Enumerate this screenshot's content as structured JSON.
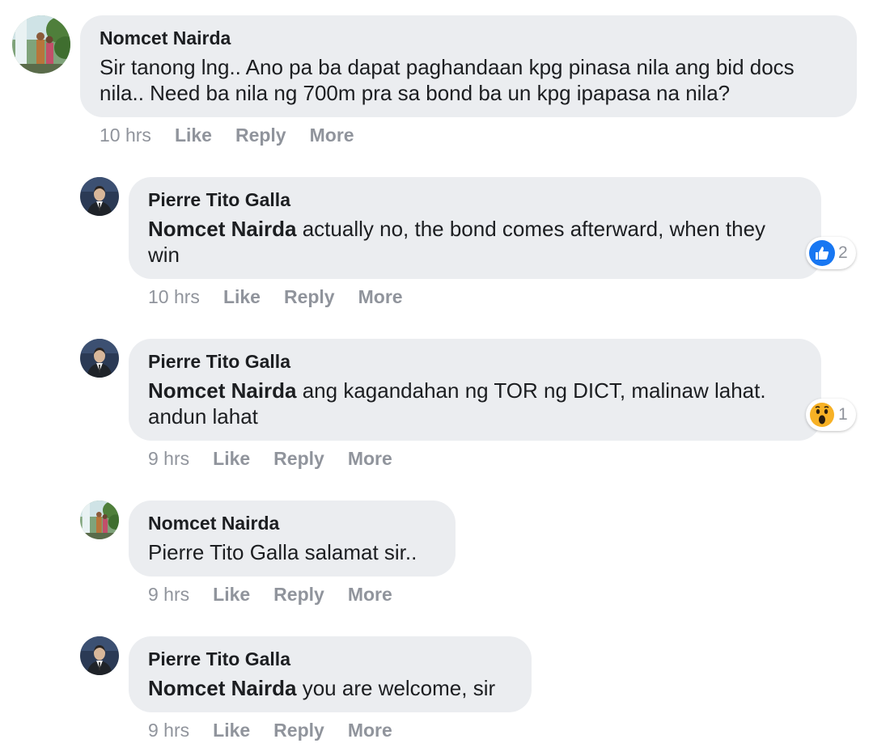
{
  "comments": [
    {
      "author": "Nomcet Nairda",
      "mention": "",
      "text": "Sir tanong lng.. Ano pa ba dapat paghandaan kpg pinasa nila ang bid docs nila.. Need ba nila ng 700m pra sa bond ba un kpg ipapasa na nila?",
      "time": "10 hrs",
      "like": "Like",
      "reply": "Reply",
      "more": "More"
    },
    {
      "author": "Pierre Tito Galla",
      "mention": "Nomcet Nairda",
      "text": " actually no, the bond comes afterward, when they win",
      "time": "10 hrs",
      "like": "Like",
      "reply": "Reply",
      "more": "More",
      "reaction": {
        "icon": "thumbs-up-icon",
        "count": "2",
        "color": "#1877f2"
      }
    },
    {
      "author": "Pierre Tito Galla",
      "mention": "Nomcet Nairda",
      "text": " ang kagandahan ng TOR ng DICT, malinaw lahat. andun lahat",
      "time": "9 hrs",
      "like": "Like",
      "reply": "Reply",
      "more": "More",
      "reaction": {
        "icon": "wow-emoji-icon",
        "count": "1",
        "color": "#f7b125"
      }
    },
    {
      "author": "Nomcet Nairda",
      "mention": "",
      "text": "Pierre Tito Galla salamat sir..",
      "time": "9 hrs",
      "like": "Like",
      "reply": "Reply",
      "more": "More"
    },
    {
      "author": "Pierre Tito Galla",
      "mention": "Nomcet Nairda",
      "text": " you are welcome, sir",
      "time": "9 hrs",
      "like": "Like",
      "reply": "Reply",
      "more": "More"
    }
  ],
  "colors": {
    "bubble": "#ebedf0",
    "meta": "#90949c",
    "text": "#1c1e21"
  }
}
